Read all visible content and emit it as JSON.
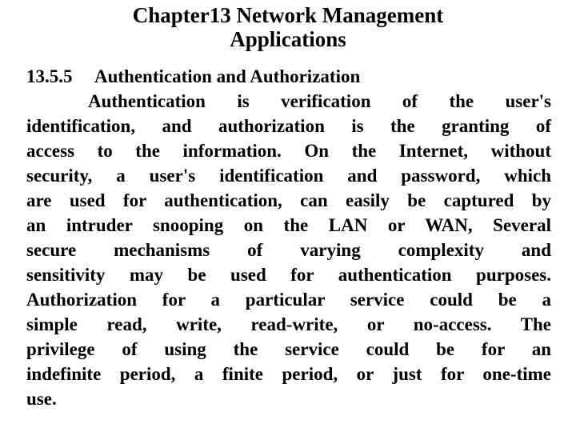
{
  "slide": {
    "background_color": "#ffffff",
    "text_color": "#000000",
    "title": {
      "line1": "Chapter13 Network Management",
      "line2": "Applications"
    },
    "section": {
      "number": "13.5.5",
      "heading": "Authentication and Authorization",
      "heading_full": "13.5.5     Authentication and Authorization"
    },
    "body": {
      "full_text": "Authentication is verification of the user's identification, and authorization is the granting of access to the information. On the Internet, without security, a user's identification and password, which are used for authentication, can easily be captured by an intruder snooping on the LAN or WAN, Several secure mechanisms of varying complexity and sensitivity may be used for authentication purposes. Authorization for a particular service could be a simple read, write, read-write, or no-access. The privilege of using the service could be for an indefinite period, a finite period, or just for one-time use.",
      "lines": [
        "Authentication is verification of the user's",
        "identification, and authorization is the granting of",
        "access to the information. On the Internet, without",
        "security, a user's identification and password, which",
        "are used for authentication, can easily be captured by",
        "an intruder snooping on the LAN or WAN, Several",
        "secure mechanisms of varying complexity and",
        "sensitivity may be used for authentication purposes.",
        "Authorization for a particular service could be a",
        "simple read, write, read-write, or no-access. The",
        "privilege of using the service could be for an",
        "indefinite period, a finite period, or just for one-time",
        "use."
      ]
    }
  }
}
